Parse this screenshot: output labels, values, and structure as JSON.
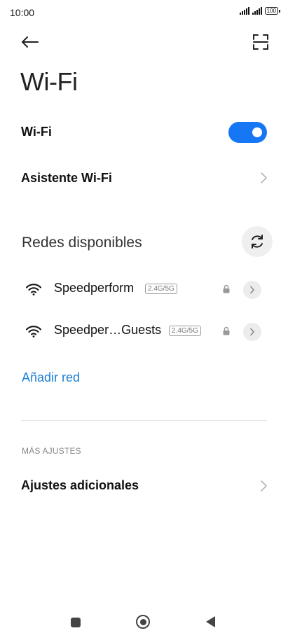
{
  "status_bar": {
    "time": "10:00",
    "battery": "100"
  },
  "header": {
    "title": "Wi-Fi"
  },
  "wifi_toggle": {
    "label": "Wi-Fi",
    "on": true
  },
  "assistant": {
    "label": "Asistente Wi-Fi"
  },
  "available": {
    "title": "Redes disponibles",
    "networks": [
      {
        "name": "Speedperform",
        "band": "2.4G/5G",
        "secured": true
      },
      {
        "name": "Speedper…Guests",
        "band": "2.4G/5G",
        "secured": true
      }
    ]
  },
  "add_network": {
    "label": "Añadir red"
  },
  "more": {
    "header": "MÁS AJUSTES",
    "extra_label": "Ajustes adicionales"
  },
  "colors": {
    "accent": "#1677f5",
    "link": "#1a7fd6"
  }
}
